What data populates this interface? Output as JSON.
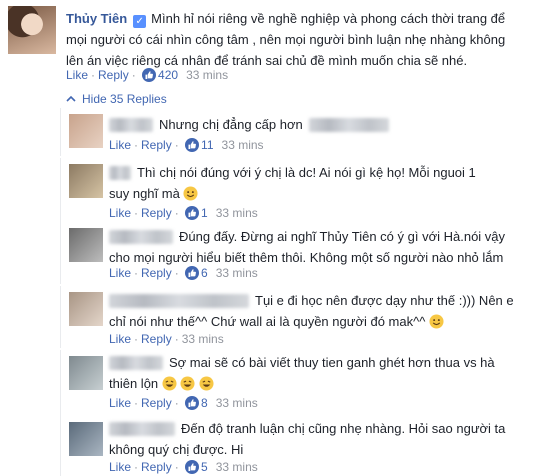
{
  "main_comment": {
    "author": "Thủy Tiên",
    "lines": [
      "Mình hỉ nói riêng về nghề nghiệp và phong cách thời trang để",
      "mọi người có cái nhìn công tâm , nên mọi người bình luận nhẹ nhàng không",
      "lên án việc riêng cá nhân để tránh sai chủ đề mình muốn chia sẽ nhé."
    ],
    "like_label": "Like",
    "reply_label": "Reply",
    "likes": "420",
    "time": "33 mins"
  },
  "hide_replies_label": "Hide 35 Replies",
  "replies": [
    {
      "lines": [
        "Nhưng chị đẳng cấp hơn"
      ],
      "like_label": "Like",
      "reply_label": "Reply",
      "likes": "11",
      "time": "33 mins"
    },
    {
      "lines": [
        "Thì chị nói đúng với ý chị là dc! Ai nói gì kệ họ! Mỗi nguoi 1",
        "suy nghĩ mà"
      ],
      "like_label": "Like",
      "reply_label": "Reply",
      "likes": "1",
      "time": "33 mins"
    },
    {
      "lines": [
        "Đúng đấy. Đừng ai nghĩ Thủy Tiên có ý gì với Hà.nói vậy",
        "cho mọi người hiểu biết thêm thôi. Không một số người nào nhỏ lắm"
      ],
      "like_label": "Like",
      "reply_label": "Reply",
      "likes": "6",
      "time": "33 mins"
    },
    {
      "lines": [
        "Tụi e đi học nên được dạy như thế :))) Nên e",
        "chỉ nói như thế^^ Chứ wall ai là quyền người đó mak^^"
      ],
      "like_label": "Like",
      "reply_label": "Reply",
      "likes": "",
      "time": "33 mins"
    },
    {
      "lines": [
        "Sợ mai sẽ có bài viết thuy tien ganh ghét hơn thua vs hà",
        "thiên lộn"
      ],
      "like_label": "Like",
      "reply_label": "Reply",
      "likes": "8",
      "time": "33 mins"
    },
    {
      "lines": [
        "Đến độ tranh luận chị cũng nhẹ nhàng. Hỏi sao người ta",
        "không quý chị được. Hi"
      ],
      "like_label": "Like",
      "reply_label": "Reply",
      "likes": "5",
      "time": "33 mins"
    }
  ],
  "colors": {
    "link": "#365899",
    "action": "#4267b2",
    "meta": "#90949c",
    "text": "#1d2129",
    "like_badge": "#4267b2"
  },
  "icons": {
    "like": "thumbs-up-icon",
    "verified": "verified-badge-icon",
    "hide": "chevron-down-icon",
    "emoji": "smiley-emoji-icon"
  }
}
